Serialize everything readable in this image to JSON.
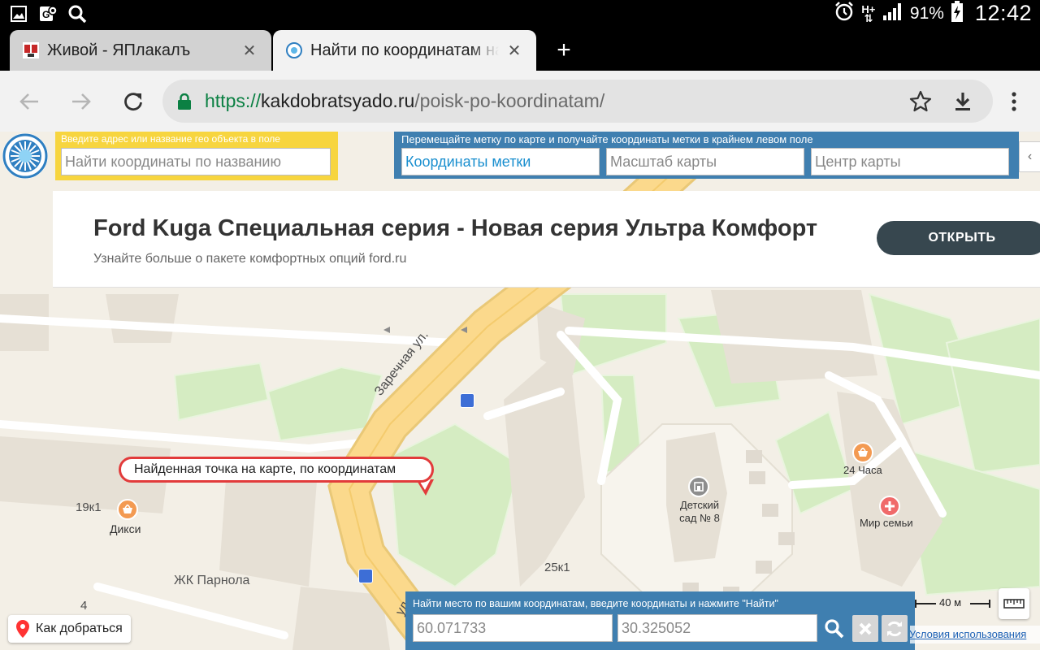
{
  "status_bar": {
    "battery": "91%",
    "time": "12:42",
    "network_top": "H+",
    "network_bottom": "⇅",
    "icons": [
      "image-icon",
      "location-icon",
      "search-icon",
      "alarm-icon",
      "network-icon",
      "signal-icon",
      "battery-charging-icon"
    ]
  },
  "tabs": [
    {
      "title": "Живой - ЯПлакалъ",
      "active": false,
      "close": "✕"
    },
    {
      "title": "Найти по координатам на карте",
      "active": true,
      "close": "✕"
    }
  ],
  "new_tab": "+",
  "toolbar": {
    "url_scheme": "https://",
    "url_host": "kakdobratsyado.ru",
    "url_path": "/poisk-po-koordinatam/"
  },
  "site": {
    "name_search": {
      "hint": "Введите адрес или название гео объекта в поле",
      "placeholder": "Найти координаты по названию"
    },
    "marker_panel": {
      "hint": "Перемещайте метку по карте и получайте координаты метки в крайнем левом поле",
      "fields": [
        {
          "placeholder": "Координаты метки"
        },
        {
          "placeholder": "Масштаб карты"
        },
        {
          "placeholder": "Центр карты"
        }
      ],
      "chevron": "‹"
    }
  },
  "ad": {
    "title": "Ford Kuga Специальная серия - Новая серия Ультра Комфорт",
    "subtitle": "Узнайте больше о пакете комфортных опций ford.ru",
    "button": "ОТКРЫТЬ"
  },
  "map": {
    "callout": "Найденная точка на карте, по координатам",
    "street_labels": [
      "Заречная ул.",
      "ул"
    ],
    "labels": {
      "building_19k1": "19к1",
      "shop_dixi": "Дикси",
      "building_25k1": "25к1",
      "zhk": "ЖК Парнола",
      "building_4": "4",
      "shop_24": "24 Часа",
      "kindergarten_line1": "Детский",
      "kindergarten_line2": "сад № 8",
      "pharmacy": "Мир семьи"
    },
    "route_button": "Как добраться",
    "scale": "40 м",
    "terms": "Условия использования"
  },
  "coord_search": {
    "hint": "Найти место по вашим координатам, введите координаты и нажмите \"Найти\"",
    "latitude": "60.071733",
    "longitude": "30.325052"
  },
  "colors": {
    "map_background": "#f3efe6",
    "road_yellow": "#fbd98c",
    "green_area": "#d5ecc2",
    "panel_blue": "#3f7fb0",
    "panel_yellow": "#f7d53f",
    "callout_red": "#e23b3b"
  }
}
